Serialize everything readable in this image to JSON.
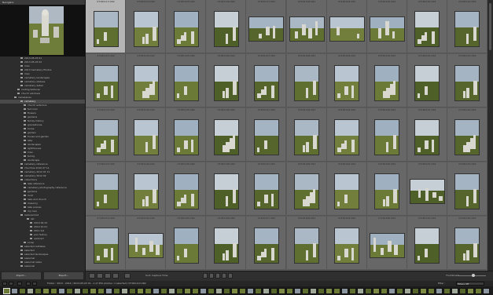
{
  "navigator": {
    "title": "Navigator"
  },
  "folders": [
    {
      "label": "2013-05-03 01",
      "count": "",
      "indent": 26,
      "sel": false
    },
    {
      "label": "2013-05-03 02",
      "count": "",
      "indent": 26,
      "sel": false
    },
    {
      "label": "misc",
      "count": "",
      "indent": 26,
      "sel": false
    },
    {
      "label": "2013 Cemetery Photos",
      "count": "",
      "indent": 26,
      "sel": false
    },
    {
      "label": "misc",
      "count": "",
      "indent": 26,
      "sel": false
    },
    {
      "label": "cemetery landscapes",
      "count": "",
      "indent": 26,
      "sel": false
    },
    {
      "label": "cemetery statues",
      "count": "",
      "indent": 26,
      "sel": false
    },
    {
      "label": "cemetery detail",
      "count": "",
      "indent": 26,
      "sel": false
    },
    {
      "label": "rusting textures",
      "count": "",
      "indent": 22,
      "sel": false
    },
    {
      "label": "church windows",
      "count": "",
      "indent": 22,
      "sel": false
    },
    {
      "label": "cemeteries",
      "count": "",
      "indent": 18,
      "sel": false
    },
    {
      "label": "cemetery",
      "count": "",
      "indent": 26,
      "sel": true
    },
    {
      "label": "church exteriors",
      "count": "",
      "indent": 30,
      "sel": false
    },
    {
      "label": "fall color",
      "count": "",
      "indent": 30,
      "sel": false
    },
    {
      "label": "flowers",
      "count": "",
      "indent": 30,
      "sel": false
    },
    {
      "label": "gardens",
      "count": "",
      "indent": 30,
      "sel": false
    },
    {
      "label": "family history",
      "count": "",
      "indent": 30,
      "sel": false
    },
    {
      "label": "gravestones",
      "count": "",
      "indent": 30,
      "sel": false
    },
    {
      "label": "home",
      "count": "",
      "indent": 30,
      "sel": false
    },
    {
      "label": "garden",
      "count": "",
      "indent": 30,
      "sel": false
    },
    {
      "label": "house and garden",
      "count": "",
      "indent": 30,
      "sel": false
    },
    {
      "label": "lake",
      "count": "",
      "indent": 30,
      "sel": false
    },
    {
      "label": "landscapes",
      "count": "",
      "indent": 30,
      "sel": false
    },
    {
      "label": "lighthouses",
      "count": "",
      "indent": 30,
      "sel": false
    },
    {
      "label": "misc",
      "count": "",
      "indent": 30,
      "sel": false
    },
    {
      "label": "family",
      "count": "",
      "indent": 30,
      "sel": false
    },
    {
      "label": "landscape",
      "count": "",
      "indent": 30,
      "sel": false
    },
    {
      "label": "cemetery reference",
      "count": "",
      "indent": 26,
      "sel": false
    },
    {
      "label": "churches 2010 07 11",
      "count": "",
      "indent": 26,
      "sel": false
    },
    {
      "label": "cemetery 2012 01 11",
      "count": "",
      "indent": 26,
      "sel": false
    },
    {
      "label": "cemetery 2012 02",
      "count": "",
      "indent": 26,
      "sel": false
    },
    {
      "label": "collections",
      "count": "",
      "indent": 26,
      "sel": false
    },
    {
      "label": "lake reference",
      "count": "",
      "indent": 30,
      "sel": false
    },
    {
      "label": "cemetery photography reference",
      "count": "",
      "indent": 30,
      "sel": false
    },
    {
      "label": "gardens",
      "count": "",
      "indent": 30,
      "sel": false
    },
    {
      "label": "rural",
      "count": "",
      "indent": 30,
      "sel": false
    },
    {
      "label": "lake and church",
      "count": "",
      "indent": 30,
      "sel": false
    },
    {
      "label": "masonry",
      "count": "",
      "indent": 30,
      "sel": false
    },
    {
      "label": "lake scenes",
      "count": "",
      "indent": 30,
      "sel": false
    },
    {
      "label": "my own",
      "count": "",
      "indent": 30,
      "sel": false
    },
    {
      "label": "restored list",
      "count": "",
      "indent": 26,
      "sel": false
    },
    {
      "label": "list",
      "count": "",
      "indent": 34,
      "sel": false
    },
    {
      "label": "2010 09 23",
      "count": "",
      "indent": 38,
      "sel": false
    },
    {
      "label": "2010 10 01",
      "count": "",
      "indent": 38,
      "sel": false
    },
    {
      "label": "2011 list",
      "count": "",
      "indent": 38,
      "sel": false
    },
    {
      "label": "pan history",
      "count": "",
      "indent": 38,
      "sel": false
    },
    {
      "label": "restored",
      "count": "",
      "indent": 38,
      "sel": false
    },
    {
      "label": "scrap",
      "count": "",
      "indent": 30,
      "sel": false
    },
    {
      "label": "selected outtakes",
      "count": "",
      "indent": 26,
      "sel": false
    },
    {
      "label": "selected",
      "count": "",
      "indent": 26,
      "sel": false
    },
    {
      "label": "selected landscapes",
      "count": "",
      "indent": 26,
      "sel": false
    },
    {
      "label": "seasonal",
      "count": "",
      "indent": 26,
      "sel": false
    },
    {
      "label": "seasonal lakes",
      "count": "",
      "indent": 26,
      "sel": false
    },
    {
      "label": "seasonal",
      "count": "",
      "indent": 26,
      "sel": false
    }
  ],
  "left_buttons": {
    "import": "Import...",
    "export": "Export..."
  },
  "grid": {
    "captions": [
      "07181113.CR2",
      "07181114.CR2",
      "07181115.CR2",
      "07181116.CR2",
      "07181117.CR2",
      "07181118.CR2",
      "07181119.CR2",
      "07181120.CR2",
      "07181121.CR2",
      "07181122.CR2",
      "07181123.CR2",
      "07181124.CR2",
      "07181125.CR2",
      "07181126.CR2",
      "07181127.CR2",
      "07181128.CR2",
      "07181129.CR2",
      "07181130.CR2",
      "07181131.CR2",
      "07181132.CR2",
      "07181133.CR2",
      "07181134.CR2",
      "07181135.CR2",
      "07181136.CR2",
      "07181137.CR2",
      "07181138.CR2",
      "07181139.CR2",
      "07181140.CR2",
      "07181141.CR2",
      "07181142.CR2",
      "07181143.CR2",
      "07181144.CR2",
      "07181145.CR2",
      "07181146.CR2",
      "07181147.CR2",
      "07181148.CR2",
      "07181149.CR2",
      "07181150.CR2",
      "07181151.CR2",
      "07181152.CR2",
      "07181153.CR2",
      "07181154.CR2",
      "07181155.CR2",
      "07181156.CR2",
      "07181157.CR2",
      "07181158.CR2",
      "07181159.CR2",
      "07181160.CR2",
      "07181161.CR2",
      "07181162.CR2"
    ]
  },
  "toolbar": {
    "sort_label": "Sort: Capture Time",
    "thumbs_label": "Thumbnails"
  },
  "filmstrip": {
    "path": "Folder : 2013 - 2014 / 2013-05-03 01 - 1 of 350 photos / 1 selected / 07181113.CR2",
    "filter_label": "Filter :",
    "filter_value": "Filters Off"
  }
}
